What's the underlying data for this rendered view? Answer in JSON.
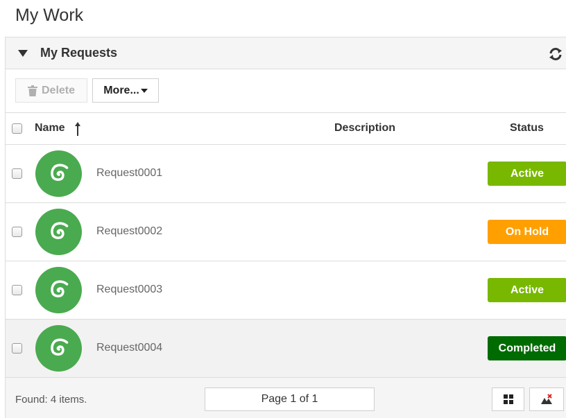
{
  "page": {
    "title": "My Work"
  },
  "panel": {
    "title": "My Requests",
    "collapse_icon": "triangle-down-icon",
    "refresh_icon": "refresh-icon"
  },
  "toolbar": {
    "delete_label": "Delete",
    "more_label": "More..."
  },
  "table": {
    "columns": {
      "name": "Name",
      "description": "Description",
      "status": "Status"
    },
    "sort": {
      "column": "Name",
      "direction": "ascending"
    },
    "rows": [
      {
        "name": "Request0001",
        "description": "",
        "status": "Active",
        "status_color": "#78b800"
      },
      {
        "name": "Request0002",
        "description": "",
        "status": "On Hold",
        "status_color": "#ffa000"
      },
      {
        "name": "Request0003",
        "description": "",
        "status": "Active",
        "status_color": "#78b800"
      },
      {
        "name": "Request0004",
        "description": "",
        "status": "Completed",
        "status_color": "#006b00"
      }
    ]
  },
  "footer": {
    "found_text": "Found: 4 items.",
    "pager_text": "Page 1 of 1"
  },
  "colors": {
    "avatar": "#4aaa4f",
    "header_bg": "#f5f5f5",
    "border": "#dcdcdc"
  }
}
